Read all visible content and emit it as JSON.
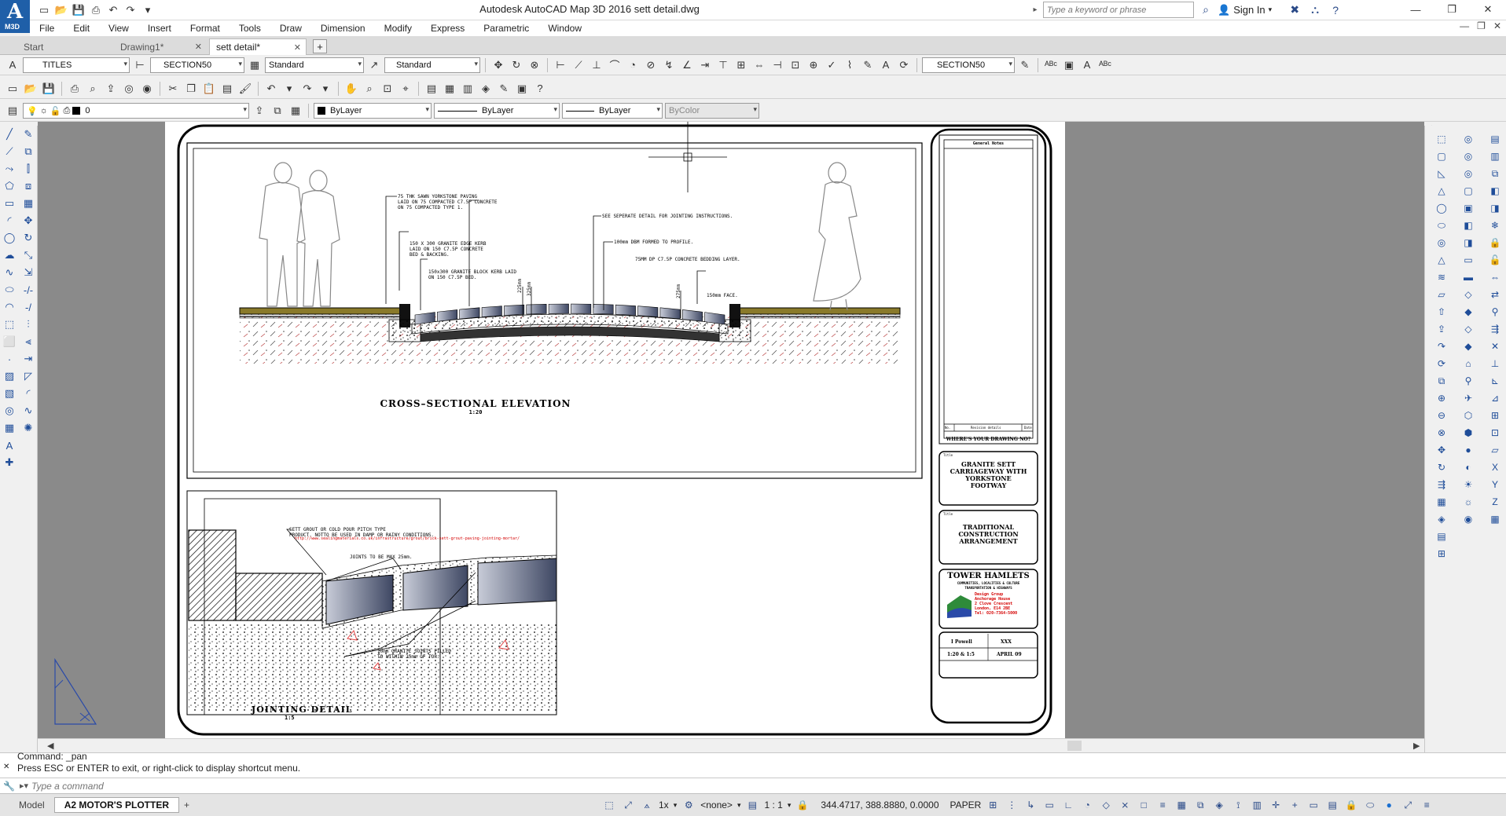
{
  "app": {
    "logo_label": "M3D",
    "title": "Autodesk AutoCAD Map 3D 2016   sett detail.dwg"
  },
  "search": {
    "placeholder": "Type a keyword or phrase"
  },
  "account": {
    "sign_in": "Sign In"
  },
  "menu": [
    "File",
    "Edit",
    "View",
    "Insert",
    "Format",
    "Tools",
    "Draw",
    "Dimension",
    "Modify",
    "Express",
    "Parametric",
    "Window"
  ],
  "tabs": [
    {
      "label": "Start",
      "closable": false
    },
    {
      "label": "Drawing1*",
      "closable": true
    },
    {
      "label": "sett detail*",
      "closable": true,
      "active": true
    }
  ],
  "styles_toolbar": {
    "text_style": "TITLES",
    "dim_style": "SECTION50",
    "table_style": "Standard",
    "multileader_style": "Standard",
    "right_dim_style": "SECTION50"
  },
  "layers_toolbar": {
    "layer": "0",
    "color": "ByLayer",
    "linetype": "ByLayer",
    "lineweight": "ByLayer",
    "plotstyle": "ByColor"
  },
  "drawing": {
    "section_title": "CROSS–SECTIONAL  ELEVATION",
    "section_scale": "1:20",
    "detail_title": "JOINTING  DETAIL",
    "detail_scale": "1:5",
    "ann_1a": "75 THK SAWN YORKSTONE PAVING",
    "ann_1b": "LAID ON 75 COMPACTED C7.5P CONCRETE",
    "ann_1c": "ON 75 COMPACTED TYPE 1.",
    "ann_2": "SEE SEPERATE DETAIL FOR JOINTING INSTRUCTIONS.",
    "ann_3": "100mm DBM FORMED TO PROFILE.",
    "ann_4a": "150 X 300 GRANITE EDGE KERB",
    "ann_4b": "LAID ON 150 C7.5P CONCRETE",
    "ann_4c": "BED & BACKING.",
    "ann_5": "75MM DP C7.5P CONCRETE BEDDING LAYER.",
    "ann_6a": "150x300 GRANITE BLOCK KERB LAID",
    "ann_6b": "ON 150 C7.5P BED.",
    "ann_7": "150mm FACE.",
    "dim_1": "225mm",
    "dim_2": "325mm",
    "dim_3": "275mm",
    "jd_1a": "SETT GROUT OR COLD POUR PITCH TYPE",
    "jd_1b": "PRODUCT. NOTTO BE USED IN DAMP OR RAINY CONDITIONS.",
    "jd_link": "http://www.sealingmaterials.co.uk/infrastructure/grout/brick-sett-grout-paving-jointing-mortar/",
    "jd_2": "JOINTS TO BE MAX 25mm.",
    "jd_3a": "10mm GRANITE JOINTS FILLED",
    "jd_3b": "TO WITHIN 25mm OF TOP.",
    "tb_general_notes": "General Notes",
    "tb_rev_no": "No.",
    "tb_rev_desc": "Revision details",
    "tb_rev_date": "Date",
    "tb_drawing_no": "WHERE'S YOUR DRAWING NO?",
    "tb_project_label": "Title",
    "tb_project_1": "GRANITE SETT",
    "tb_project_2": "CARRIAGEWAY WITH",
    "tb_project_3": "YORKSTONE",
    "tb_project_4": "FOOTWAY",
    "tb_sub_label": "Title",
    "tb_sub_1": "TRADITIONAL",
    "tb_sub_2": "CONSTRUCTION",
    "tb_sub_3": "ARRANGEMENT",
    "tb_org_1": "TOWER  HAMLETS",
    "tb_org_2": "COMMUNITIES, LOCALITIES & CULTURE",
    "tb_org_3": "TRANSPORTATION & HIGHWAYS",
    "tb_org_4": "Design Group",
    "tb_org_5": "Anchorage House",
    "tb_org_6": "2 Clove Crescent",
    "tb_org_7": "London, E14 2BE",
    "tb_org_8": "Tel: 020-7364-5000",
    "tb_drawn_by": "I Powell",
    "tb_checked": "XXX",
    "tb_scale": "1:20 & 1:5",
    "tb_date": "APRIL 09"
  },
  "command": {
    "history_1": "Command: _pan",
    "history_2": "Press ESC or ENTER to exit, or right-click to display shortcut menu.",
    "placeholder": "Type a command"
  },
  "status": {
    "layout_tabs": [
      "Model",
      "A2 MOTOR'S PLOTTER"
    ],
    "annotation_scale": "1x",
    "isolation": "<none>",
    "viewport_scale": "1 : 1",
    "coordinates": "344.4717, 388.8880, 0.0000",
    "space": "PAPER"
  },
  "colors": {
    "drawing_bg": "#8a8a8a",
    "paper": "#ffffff",
    "accent": "#1f5fa8",
    "sett_fill": "#3e4763",
    "link_red": "#d40000"
  }
}
